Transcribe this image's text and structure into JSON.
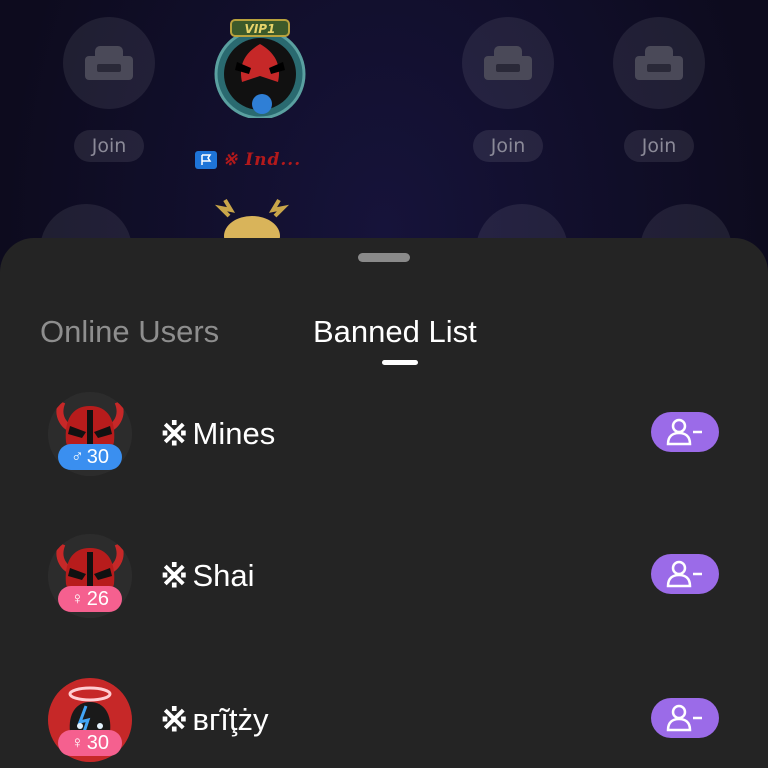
{
  "room": {
    "seats": [
      {
        "id": "seat-1",
        "join_label": "Join"
      },
      {
        "id": "seat-3",
        "join_label": "Join"
      },
      {
        "id": "seat-4",
        "join_label": "Join"
      }
    ],
    "vip_label": "VIP1",
    "host_name": "※ Ind..."
  },
  "sheet": {
    "tabs": [
      {
        "label": "Online Users",
        "active": false
      },
      {
        "label": "Banned List",
        "active": true
      }
    ],
    "banned_users": [
      {
        "name": "Mines",
        "name_prefix": "※",
        "gender": "male",
        "gender_symbol": "♂",
        "age": "30",
        "action_icon": "remove-user-icon"
      },
      {
        "name": "Shai",
        "name_prefix": "※",
        "gender": "female",
        "gender_symbol": "♀",
        "age": "26",
        "action_icon": "remove-user-icon"
      },
      {
        "name": "вгĩţżу",
        "name_prefix": "※",
        "gender": "female",
        "gender_symbol": "♀",
        "age": "30",
        "action_icon": "remove-user-icon"
      }
    ]
  },
  "colors": {
    "sheet_bg": "#242424",
    "accent_purple": "#9b6be8",
    "male_badge": "#3a8ff0",
    "female_badge": "#f5608f",
    "background": "#0d0b1e"
  }
}
